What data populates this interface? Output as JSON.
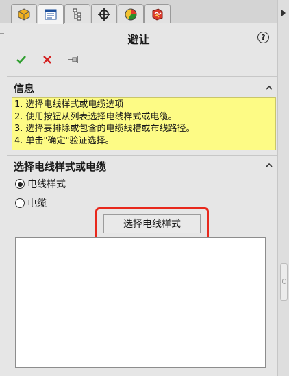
{
  "window": {
    "title": "避让"
  },
  "tabs": [
    {
      "name": "featuremanager",
      "icon": "feature-tree-icon"
    },
    {
      "name": "propertymanager",
      "icon": "property-manager-icon"
    },
    {
      "name": "configurationmanager",
      "icon": "configuration-icon"
    },
    {
      "name": "dimxpert",
      "icon": "crosshair-icon"
    },
    {
      "name": "display",
      "icon": "display-pie-icon"
    },
    {
      "name": "routing",
      "icon": "routing-icon"
    }
  ],
  "toolbar": {
    "help_label": "?"
  },
  "sections": {
    "info": {
      "title": "信息",
      "lines": [
        "1. 选择电线样式或电缆选项",
        "2. 使用按钮从列表选择电线样式或电缆。",
        "3. 选择要排除或包含的电缆线槽或布线路径。",
        "4. 单击\"确定\"验证选择。"
      ]
    },
    "select": {
      "title": "选择电线样式或电缆",
      "options": [
        {
          "label": "电线样式",
          "checked": true
        },
        {
          "label": "电缆",
          "checked": false
        }
      ],
      "button_label": "选择电线样式"
    }
  },
  "colors": {
    "info_bg": "#fdfb85",
    "highlight": "#e8281c",
    "ok": "#2e9e2e",
    "cancel": "#d42020"
  }
}
